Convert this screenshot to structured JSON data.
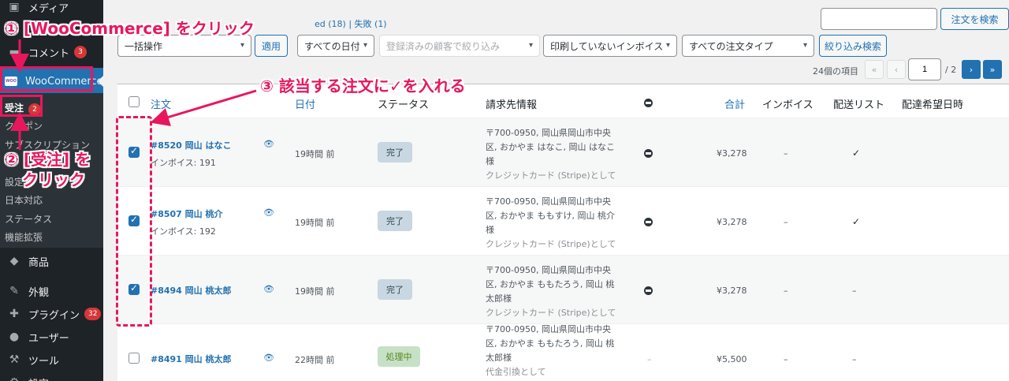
{
  "sidebar": {
    "media": "メディア",
    "comments": "コメント",
    "comments_count": "3",
    "woocommerce": "WooCommerce",
    "woo_logo": "WOO",
    "submenu": {
      "orders": "受注",
      "orders_count": "2",
      "coupon": "クーポン",
      "subscriptions": "サブスクリプション",
      "settings": "設定",
      "japan": "日本対応",
      "status": "ステータス",
      "extensions": "機能拡張"
    },
    "products": "商品",
    "appearance": "外観",
    "plugins": "プラグイン",
    "plugins_count": "32",
    "users": "ユーザー",
    "tools": "ツール",
    "settings2": "設定"
  },
  "top": {
    "status_links": "ed (18) | 失敗 (1)",
    "search_placeholder": "",
    "search_button": "注文を検索",
    "bulk_action": "一括操作",
    "apply": "適用",
    "all_dates": "すべての日付",
    "customer_placeholder": "登録済みの顧客で絞り込み",
    "invoice_filter": "印刷していないインボイス",
    "order_types": "すべての注文タイプ",
    "filter_button": "絞り込み検索",
    "items_count": "24個の項目",
    "page_current": "1",
    "page_total": "/ 2",
    "first": "«",
    "prev": "‹",
    "next": "›",
    "last": "»"
  },
  "columns": {
    "order": "注文",
    "date": "日付",
    "status": "ステータス",
    "billing": "請求先情報",
    "total": "合計",
    "invoice": "インボイス",
    "shipping_list": "配送リスト",
    "delivery_date": "配達希望日時"
  },
  "orders": [
    {
      "name": "#8520 岡山 はなこ",
      "invoice": "インボイス: 191",
      "date": "19時間 前",
      "status": "完了",
      "addr1": "〒700-0950, 岡山県岡山市中央",
      "addr2": "区, おかやま はなこ, 岡山 はなこ",
      "addr3": "様",
      "pay": "クレジットカード (Stripe)として",
      "total": "¥3,278",
      "inv": "–",
      "ship": "✓",
      "checked": true
    },
    {
      "name": "#8507 岡山 桃介",
      "invoice": "インボイス: 192",
      "date": "19時間 前",
      "status": "完了",
      "addr1": "〒700-0950, 岡山県岡山市中央",
      "addr2": "区, おかやま ももすけ, 岡山 桃介",
      "addr3": "様",
      "pay": "クレジットカード (Stripe)として",
      "total": "¥3,278",
      "inv": "–",
      "ship": "✓",
      "checked": true
    },
    {
      "name": "#8494 岡山 桃太郎",
      "invoice": "",
      "date": "19時間 前",
      "status": "完了",
      "addr1": "〒700-0950, 岡山県岡山市中央",
      "addr2": "区, おかやま ももたろう, 岡山 桃",
      "addr3": "太郎様",
      "pay": "クレジットカード (Stripe)として",
      "total": "¥3,278",
      "inv": "–",
      "ship": "–",
      "checked": true
    },
    {
      "name": "#8491 岡山 桃太郎",
      "invoice": "",
      "date": "22時間 前",
      "status": "処理中",
      "addr1": "〒700-0950, 岡山県岡山市中央",
      "addr2": "区, おかやま ももたろう, 岡山 桃",
      "addr3": "太郎様",
      "pay": "代金引換として",
      "total": "¥5,500",
      "inv": "–",
      "ship": "–",
      "checked": false
    }
  ],
  "annotations": {
    "step1": "① [WooCommerce] をクリック",
    "step2a": "② [受注] を",
    "step2b": "クリック",
    "step3": "③ 該当する注文に✓を入れる"
  },
  "colors": {
    "accent": "#e8175d",
    "wp_blue": "#2271b1",
    "sidebar": "#1d2327"
  }
}
